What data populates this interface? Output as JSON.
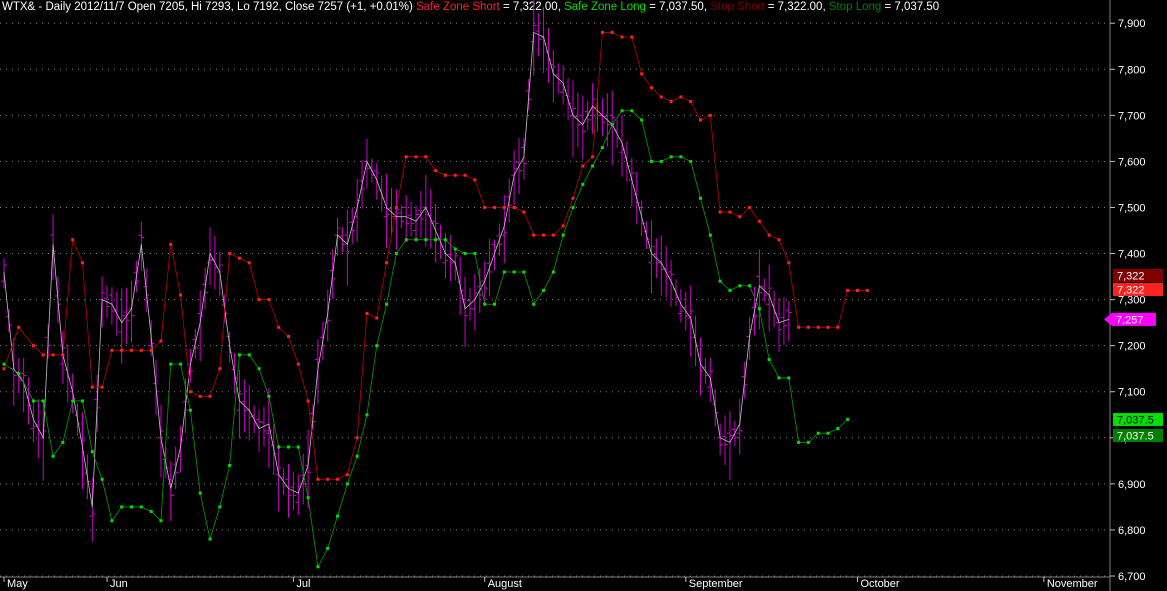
{
  "header": {
    "instrument": "WTX& - Daily 2012/11/7 Open 7205, Hi 7293, Lo 7192, Close 7257 (+1, +0.01%)",
    "sz_short_label": "Safe Zone Short",
    "sz_short_value": "= 7,322.00,",
    "sz_long_label": "Safe Zone Long",
    "sz_long_value": "= 7,037.50,",
    "stop_short_label": "Stop Short",
    "stop_short_value": "= 7,322.00,",
    "stop_long_label": "Stop Long",
    "stop_long_value": "= 7,037.50"
  },
  "colors": {
    "background": "#000000",
    "price_bars": "#d000d0",
    "safe_zone_short": "#ff2020",
    "safe_zone_long": "#00e000",
    "stop_short": "#800000",
    "stop_long": "#008000",
    "grid": "#808080",
    "price_line": "#c0c0c0"
  },
  "chart_data": {
    "type": "line",
    "title": "WTX& - Daily",
    "ylim": [
      6700,
      7920
    ],
    "y_ticks": [
      "6,700",
      "6,800",
      "6,900",
      "7,000",
      "7,100",
      "7,200",
      "7,300",
      "7,400",
      "7,500",
      "7,600",
      "7,700",
      "7,800",
      "7,900"
    ],
    "grid": "horizontal dotted",
    "x_months": [
      "May",
      "Jun",
      "Jul",
      "August",
      "September",
      "October",
      "November"
    ],
    "month_start_index": [
      0,
      21,
      59,
      98,
      139,
      174,
      212
    ],
    "n_days": 222,
    "right_labels": {
      "stop_short": "7,322",
      "safe_zone_short": "7,322",
      "last_price": "7,257",
      "safe_zone_long": "7,037.5",
      "stop_long": "7,037.5"
    },
    "close_path_days": [
      0,
      2,
      4,
      6,
      8,
      10,
      12,
      14,
      16,
      18,
      20,
      22,
      24,
      26,
      28,
      30,
      32,
      34,
      36,
      38,
      40,
      42,
      44,
      46,
      48,
      50,
      52,
      54,
      56,
      58,
      60,
      62,
      64,
      66,
      68,
      70,
      72,
      74,
      76,
      78,
      80,
      82,
      84,
      86,
      88,
      90,
      92,
      94,
      96,
      98,
      100,
      102,
      104,
      106,
      108,
      110,
      112,
      114,
      116,
      118,
      120,
      122,
      124,
      126,
      128,
      130,
      132,
      134,
      136,
      138,
      140,
      142,
      144,
      146,
      148,
      150,
      152,
      154,
      156,
      158,
      160,
      162,
      164,
      166,
      168,
      170,
      172,
      174,
      176,
      178,
      180,
      182,
      184,
      186,
      188,
      190,
      192,
      194,
      196,
      198,
      200,
      202,
      204,
      206,
      208,
      210,
      212,
      214,
      216,
      218,
      220
    ],
    "close_values": [
      7360,
      7150,
      7120,
      7040,
      7000,
      7420,
      7180,
      7100,
      6980,
      6850,
      7300,
      7290,
      7250,
      7280,
      7420,
      7220,
      7000,
      6890,
      6980,
      7160,
      7250,
      7400,
      7360,
      7200,
      7080,
      7060,
      7020,
      7030,
      6920,
      6890,
      6880,
      6940,
      7150,
      7270,
      7440,
      7420,
      7500,
      7600,
      7560,
      7500,
      7480,
      7480,
      7470,
      7500,
      7450,
      7400,
      7380,
      7280,
      7300,
      7340,
      7400,
      7460,
      7570,
      7610,
      7880,
      7870,
      7790,
      7770,
      7700,
      7680,
      7720,
      7700,
      7680,
      7640,
      7560,
      7480,
      7400,
      7380,
      7340,
      7290,
      7260,
      7160,
      7130,
      7000,
      6990,
      7030,
      7220,
      7330,
      7310,
      7250,
      7257
    ],
    "series": [
      {
        "name": "Safe Zone Short",
        "type": "dotted-step",
        "values": [
          [
            0,
            7150
          ],
          [
            3,
            7240
          ],
          [
            6,
            7200
          ],
          [
            8,
            7180
          ],
          [
            10,
            7180
          ],
          [
            12,
            7180
          ],
          [
            14,
            7430
          ],
          [
            16,
            7380
          ],
          [
            18,
            7110
          ],
          [
            20,
            7110
          ],
          [
            22,
            7190
          ],
          [
            24,
            7190
          ],
          [
            26,
            7190
          ],
          [
            28,
            7190
          ],
          [
            30,
            7190
          ],
          [
            32,
            7210
          ],
          [
            34,
            7420
          ],
          [
            36,
            7310
          ],
          [
            38,
            7100
          ],
          [
            40,
            7090
          ],
          [
            42,
            7090
          ],
          [
            44,
            7150
          ],
          [
            46,
            7400
          ],
          [
            48,
            7390
          ],
          [
            50,
            7380
          ],
          [
            52,
            7300
          ],
          [
            54,
            7300
          ],
          [
            56,
            7240
          ],
          [
            58,
            7220
          ],
          [
            60,
            7160
          ],
          [
            62,
            7080
          ],
          [
            64,
            6910
          ],
          [
            66,
            6910
          ],
          [
            68,
            6910
          ],
          [
            70,
            6920
          ],
          [
            72,
            7000
          ],
          [
            74,
            7270
          ],
          [
            76,
            7260
          ],
          [
            78,
            7380
          ],
          [
            80,
            7500
          ],
          [
            82,
            7610
          ],
          [
            84,
            7610
          ],
          [
            86,
            7610
          ],
          [
            88,
            7580
          ],
          [
            90,
            7570
          ],
          [
            92,
            7570
          ],
          [
            94,
            7570
          ],
          [
            96,
            7560
          ],
          [
            98,
            7500
          ],
          [
            100,
            7500
          ],
          [
            102,
            7500
          ],
          [
            104,
            7500
          ],
          [
            106,
            7490
          ],
          [
            108,
            7440
          ],
          [
            110,
            7440
          ],
          [
            112,
            7440
          ],
          [
            114,
            7460
          ],
          [
            116,
            7520
          ],
          [
            118,
            7590
          ],
          [
            120,
            7610
          ],
          [
            122,
            7880
          ],
          [
            124,
            7880
          ],
          [
            126,
            7870
          ],
          [
            128,
            7870
          ],
          [
            130,
            7790
          ],
          [
            132,
            7760
          ],
          [
            134,
            7740
          ],
          [
            136,
            7730
          ],
          [
            138,
            7740
          ],
          [
            140,
            7730
          ],
          [
            142,
            7690
          ],
          [
            144,
            7700
          ],
          [
            146,
            7490
          ],
          [
            148,
            7490
          ],
          [
            150,
            7480
          ],
          [
            152,
            7500
          ],
          [
            154,
            7470
          ],
          [
            156,
            7440
          ],
          [
            158,
            7430
          ],
          [
            160,
            7380
          ],
          [
            162,
            7240
          ],
          [
            164,
            7240
          ],
          [
            166,
            7240
          ],
          [
            168,
            7240
          ],
          [
            170,
            7240
          ],
          [
            172,
            7320
          ],
          [
            174,
            7320
          ],
          [
            176,
            7320
          ]
        ]
      },
      {
        "name": "Safe Zone Long",
        "type": "dotted-step",
        "values": [
          [
            0,
            7160
          ],
          [
            3,
            7140
          ],
          [
            6,
            7080
          ],
          [
            8,
            7080
          ],
          [
            10,
            6960
          ],
          [
            12,
            6990
          ],
          [
            14,
            7080
          ],
          [
            16,
            7080
          ],
          [
            18,
            6970
          ],
          [
            20,
            6910
          ],
          [
            22,
            6820
          ],
          [
            24,
            6850
          ],
          [
            26,
            6850
          ],
          [
            28,
            6850
          ],
          [
            30,
            6840
          ],
          [
            32,
            6820
          ],
          [
            34,
            7160
          ],
          [
            36,
            7160
          ],
          [
            38,
            7060
          ],
          [
            40,
            6880
          ],
          [
            42,
            6780
          ],
          [
            44,
            6850
          ],
          [
            46,
            6940
          ],
          [
            48,
            7180
          ],
          [
            50,
            7180
          ],
          [
            52,
            7150
          ],
          [
            54,
            7090
          ],
          [
            56,
            6980
          ],
          [
            58,
            6980
          ],
          [
            60,
            6980
          ],
          [
            62,
            6870
          ],
          [
            64,
            6720
          ],
          [
            66,
            6760
          ],
          [
            68,
            6830
          ],
          [
            70,
            6900
          ],
          [
            72,
            6960
          ],
          [
            74,
            7050
          ],
          [
            76,
            7200
          ],
          [
            78,
            7290
          ],
          [
            80,
            7400
          ],
          [
            82,
            7430
          ],
          [
            84,
            7430
          ],
          [
            86,
            7430
          ],
          [
            88,
            7430
          ],
          [
            90,
            7430
          ],
          [
            92,
            7410
          ],
          [
            94,
            7400
          ],
          [
            96,
            7400
          ],
          [
            98,
            7290
          ],
          [
            100,
            7290
          ],
          [
            102,
            7360
          ],
          [
            104,
            7360
          ],
          [
            106,
            7360
          ],
          [
            108,
            7290
          ],
          [
            110,
            7320
          ],
          [
            112,
            7360
          ],
          [
            114,
            7440
          ],
          [
            116,
            7500
          ],
          [
            118,
            7550
          ],
          [
            120,
            7590
          ],
          [
            122,
            7630
          ],
          [
            124,
            7680
          ],
          [
            126,
            7710
          ],
          [
            128,
            7710
          ],
          [
            130,
            7690
          ],
          [
            132,
            7600
          ],
          [
            134,
            7600
          ],
          [
            136,
            7610
          ],
          [
            138,
            7610
          ],
          [
            140,
            7600
          ],
          [
            142,
            7520
          ],
          [
            144,
            7440
          ],
          [
            146,
            7340
          ],
          [
            148,
            7320
          ],
          [
            150,
            7330
          ],
          [
            152,
            7330
          ],
          [
            154,
            7280
          ],
          [
            156,
            7170
          ],
          [
            158,
            7130
          ],
          [
            160,
            7130
          ],
          [
            162,
            6990
          ],
          [
            164,
            6990
          ],
          [
            166,
            7010
          ],
          [
            168,
            7010
          ],
          [
            170,
            7020
          ],
          [
            172,
            7040
          ]
        ]
      }
    ],
    "ohlc_sample_note": "vertical magenta price bars follow the close path"
  }
}
